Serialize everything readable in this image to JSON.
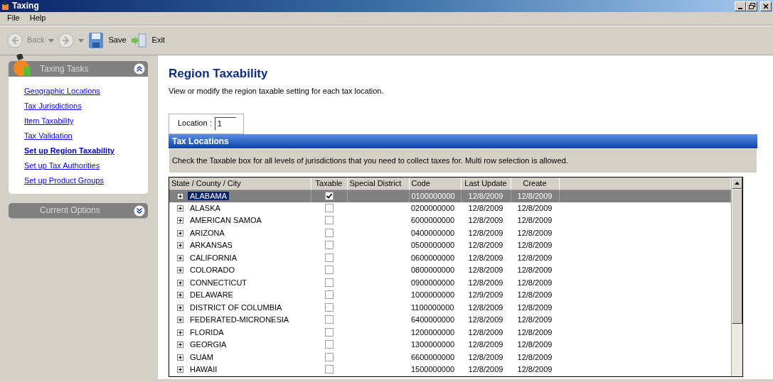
{
  "window": {
    "title": "Taxing"
  },
  "menu": [
    "File",
    "Help"
  ],
  "toolbar": [
    {
      "kind": "back",
      "label": "Back",
      "disabled": true
    },
    {
      "kind": "forward",
      "disabled": true
    },
    {
      "kind": "save",
      "label": "Save",
      "disabled": false
    },
    {
      "kind": "exit",
      "label": "Exit",
      "disabled": false
    }
  ],
  "sidebar": {
    "panels": [
      {
        "title": "Taxing Tasks",
        "expanded": true,
        "items": [
          {
            "label": "Geographic Locations",
            "selected": false
          },
          {
            "label": "Tax Jurisdictions",
            "selected": false
          },
          {
            "label": "Item Taxability",
            "selected": false
          },
          {
            "label": "Tax Validation",
            "selected": false
          },
          {
            "label": "Set up Region Taxability",
            "selected": true
          },
          {
            "label": "Set up Tax Authorities",
            "selected": false
          },
          {
            "label": "Set up Product Groups",
            "selected": false
          }
        ]
      },
      {
        "title": "Current Options",
        "expanded": false
      }
    ]
  },
  "page": {
    "title": "Region Taxability",
    "description": "View or modify the region taxable setting for each tax location.",
    "location": {
      "label": "Location :",
      "value": "1"
    }
  },
  "table": {
    "title": "Tax Locations",
    "instructions": "Check the Taxable box for all levels of jurisdictions that you need to collect taxes for.  Multi row selection is allowed.",
    "columns": [
      "State / County / City",
      "Taxable",
      "Special District",
      "Code",
      "Last Update",
      "Create"
    ],
    "rows": [
      {
        "name": "ALABAMA",
        "taxable": true,
        "code": "0100000000",
        "last_update": "12/8/2009",
        "create": "12/8/2009",
        "selected": true,
        "expanded": false
      },
      {
        "name": "ALASKA",
        "taxable": false,
        "code": "0200000000",
        "last_update": "12/8/2009",
        "create": "12/8/2009",
        "selected": false,
        "expanded": false
      },
      {
        "name": "AMERICAN SAMOA",
        "taxable": false,
        "code": "6000000000",
        "last_update": "12/8/2009",
        "create": "12/8/2009",
        "selected": false,
        "expanded": false
      },
      {
        "name": "ARIZONA",
        "taxable": false,
        "code": "0400000000",
        "last_update": "12/8/2009",
        "create": "12/8/2009",
        "selected": false,
        "expanded": false
      },
      {
        "name": "ARKANSAS",
        "taxable": false,
        "code": "0500000000",
        "last_update": "12/8/2009",
        "create": "12/8/2009",
        "selected": false,
        "expanded": false
      },
      {
        "name": "CALIFORNIA",
        "taxable": false,
        "code": "0600000000",
        "last_update": "12/8/2009",
        "create": "12/8/2009",
        "selected": false,
        "expanded": false
      },
      {
        "name": "COLORADO",
        "taxable": false,
        "code": "0800000000",
        "last_update": "12/8/2009",
        "create": "12/8/2009",
        "selected": false,
        "expanded": false
      },
      {
        "name": "CONNECTICUT",
        "taxable": false,
        "code": "0900000000",
        "last_update": "12/8/2009",
        "create": "12/8/2009",
        "selected": false,
        "expanded": false
      },
      {
        "name": "DELAWARE",
        "taxable": false,
        "code": "1000000000",
        "last_update": "12/9/2009",
        "create": "12/8/2009",
        "selected": false,
        "expanded": false
      },
      {
        "name": "DISTRICT OF COLUMBIA",
        "taxable": false,
        "code": "1100000000",
        "last_update": "12/8/2009",
        "create": "12/8/2009",
        "selected": false,
        "expanded": false
      },
      {
        "name": "FEDERATED-MICRONESIA",
        "taxable": false,
        "code": "6400000000",
        "last_update": "12/8/2009",
        "create": "12/8/2009",
        "selected": false,
        "expanded": false
      },
      {
        "name": "FLORIDA",
        "taxable": false,
        "code": "1200000000",
        "last_update": "12/8/2009",
        "create": "12/8/2009",
        "selected": false,
        "expanded": false
      },
      {
        "name": "GEORGIA",
        "taxable": false,
        "code": "1300000000",
        "last_update": "12/8/2009",
        "create": "12/8/2009",
        "selected": false,
        "expanded": false
      },
      {
        "name": "GUAM",
        "taxable": false,
        "code": "6600000000",
        "last_update": "12/8/2009",
        "create": "12/8/2009",
        "selected": false,
        "expanded": false
      },
      {
        "name": "HAWAII",
        "taxable": false,
        "code": "1500000000",
        "last_update": "12/8/2009",
        "create": "12/8/2009",
        "selected": false,
        "expanded": false
      }
    ]
  }
}
